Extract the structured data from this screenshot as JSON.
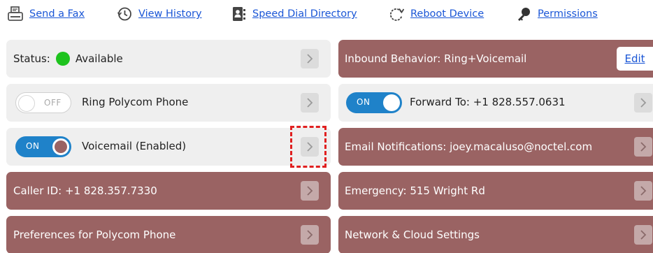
{
  "toolbar": {
    "send_fax": "Send a Fax",
    "view_history": "View History",
    "speed_dial": "Speed Dial Directory",
    "reboot": "Reboot Device",
    "permissions": "Permissions"
  },
  "icons": {
    "send_fax": "fax-icon",
    "view_history": "history-clock-icon",
    "speed_dial": "contacts-book-icon",
    "reboot": "refresh-icon",
    "permissions": "key-icon",
    "arrow": "chevron-right-icon"
  },
  "left_column": {
    "status": {
      "label": "Status:",
      "value": "Available",
      "dot_color": "#1ec31e"
    },
    "ring_phone": {
      "toggle": "OFF",
      "label": "Ring Polycom Phone"
    },
    "voicemail": {
      "toggle": "ON",
      "label": "Voicemail (Enabled)"
    },
    "caller_id": {
      "label": "Caller ID: +1 828.357.7330"
    },
    "preferences": {
      "label": "Preferences for Polycom Phone"
    }
  },
  "right_column": {
    "inbound": {
      "label": "Inbound Behavior: Ring+Voicemail",
      "edit": "Edit"
    },
    "forward": {
      "toggle": "ON",
      "label": "Forward To: +1 828.557.0631"
    },
    "email": {
      "label": "Email Notifications: joey.macaluso@noctel.com"
    },
    "emergency": {
      "label": "Emergency: 515 Wright Rd"
    },
    "network": {
      "label": "Network & Cloud Settings"
    }
  },
  "colors": {
    "accent_red": "#9a6363",
    "toggle_blue": "#1f82c9",
    "link_blue": "#1a56d6",
    "card_grey": "#efefef"
  }
}
